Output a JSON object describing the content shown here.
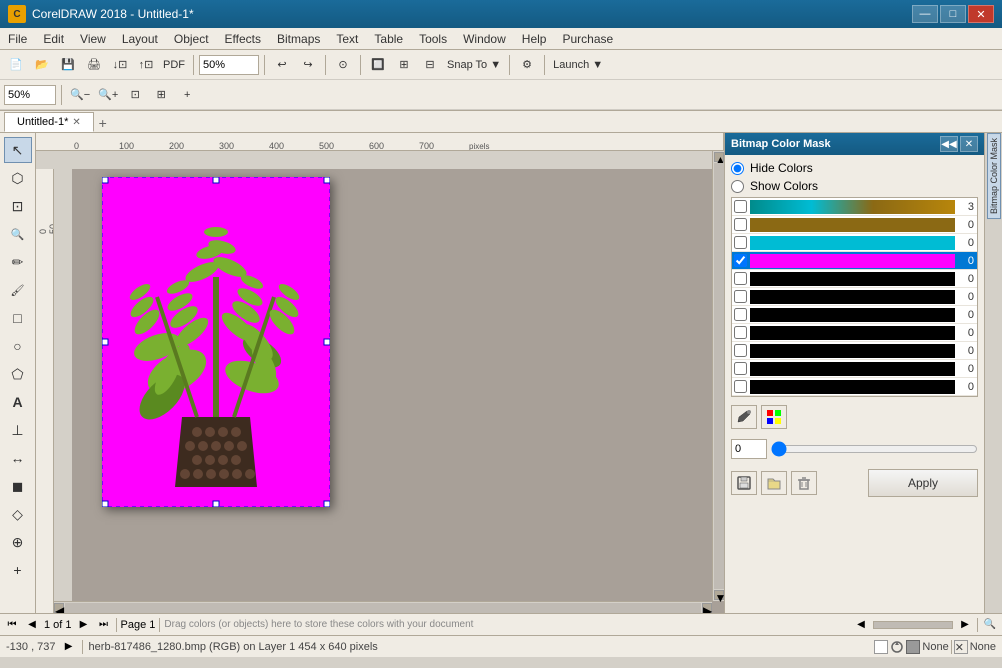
{
  "titlebar": {
    "title": "CorelDRAW 2018 - Untitled-1*",
    "logo": "C",
    "minimize": "—",
    "maximize": "□",
    "close": "✕"
  },
  "menubar": {
    "items": [
      "File",
      "Edit",
      "View",
      "Layout",
      "Object",
      "Effects",
      "Bitmaps",
      "Text",
      "Table",
      "Tools",
      "Window",
      "Help",
      "Purchase"
    ]
  },
  "toolbar1": {
    "zoom_label": "50%",
    "undo": "↩",
    "redo": "↪",
    "snap_to": "Snap To ▼",
    "launch": "Launch ▼",
    "zoom_pct": "50%"
  },
  "zoom_toolbar": {
    "zoom_value": "50%",
    "zoom_out": "−",
    "zoom_in": "+"
  },
  "tabs": {
    "active_tab": "Untitled-1*",
    "add_tab": "+"
  },
  "canvas": {
    "ruler_marks": [
      "0",
      "100",
      "200",
      "300",
      "400",
      "500",
      "600",
      "700",
      "pixels"
    ]
  },
  "bitmap_color_mask": {
    "title": "Bitmap Color Mask",
    "hide_colors": "Hide Colors",
    "show_colors": "Show Colors",
    "colors": [
      {
        "checked": false,
        "color": "#00bcd4",
        "num": "3"
      },
      {
        "checked": false,
        "color": "#8B6914",
        "num": "0"
      },
      {
        "checked": false,
        "color": "#00bcd4",
        "num": "0"
      },
      {
        "checked": true,
        "color": "#ff00ff",
        "num": "0",
        "selected": true
      },
      {
        "checked": false,
        "color": "#000000",
        "num": "0"
      },
      {
        "checked": false,
        "color": "#000000",
        "num": "0"
      },
      {
        "checked": false,
        "color": "#000000",
        "num": "0"
      },
      {
        "checked": false,
        "color": "#000000",
        "num": "0"
      },
      {
        "checked": false,
        "color": "#000000",
        "num": "0"
      },
      {
        "checked": false,
        "color": "#000000",
        "num": "0"
      },
      {
        "checked": false,
        "color": "#000000",
        "num": "0"
      }
    ],
    "tolerance_value": "0",
    "apply_label": "Apply",
    "eyedropper_icon": "✏",
    "copy_icon": "⊞"
  },
  "statusbar": {
    "page_nav": {
      "first": "⏮",
      "prev": "◀",
      "page_of": "1 of 1",
      "next": "▶",
      "last": "⏭"
    },
    "page_label": "Page 1",
    "drag_hint": "Drag colors (or objects) here to store these colors with your document",
    "zoom_icon": "🔍"
  },
  "bottombar": {
    "coords": "-130 , 737",
    "expand_icon": "▶",
    "file_info": "herb-817486_1280.bmp (RGB) on Layer 1 454 x 640 pixels",
    "color_model_icon": "⬜",
    "fill_label": "None",
    "stroke_label": "None"
  },
  "toolbox": {
    "tools": [
      {
        "name": "select",
        "icon": "↖"
      },
      {
        "name": "shape",
        "icon": "⬡"
      },
      {
        "name": "crop",
        "icon": "⊡"
      },
      {
        "name": "zoom-tool",
        "icon": "🔍"
      },
      {
        "name": "freehand",
        "icon": "✏"
      },
      {
        "name": "artistic-media",
        "icon": "🖌"
      },
      {
        "name": "rectangle",
        "icon": "□"
      },
      {
        "name": "ellipse",
        "icon": "○"
      },
      {
        "name": "polygon",
        "icon": "⬠"
      },
      {
        "name": "text-tool",
        "icon": "A"
      },
      {
        "name": "parallel-dimension",
        "icon": "⊥"
      },
      {
        "name": "connector",
        "icon": "↔"
      },
      {
        "name": "drop-shadow",
        "icon": "◼"
      },
      {
        "name": "transparency",
        "icon": "◇"
      },
      {
        "name": "color-eyedropper",
        "icon": "⊕"
      },
      {
        "name": "interactive-fill",
        "icon": "+"
      }
    ]
  }
}
